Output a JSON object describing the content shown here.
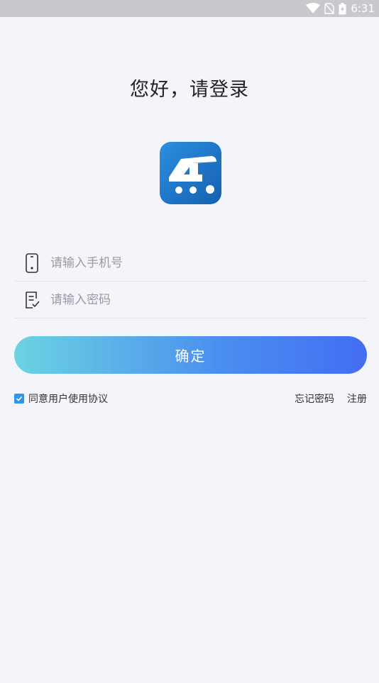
{
  "status_bar": {
    "time": "6:31",
    "icons": [
      "wifi-icon",
      "no-sim-icon",
      "battery-charging-icon"
    ]
  },
  "login": {
    "title": "您好，请登录",
    "logo_icon": "app-logo-icon",
    "phone": {
      "icon": "phone-icon",
      "placeholder": "请输入手机号",
      "value": ""
    },
    "password": {
      "icon": "password-note-icon",
      "placeholder": "请输入密码",
      "value": ""
    },
    "confirm_label": "确定",
    "agreement": {
      "checked": true,
      "label": "同意用户使用协议"
    },
    "forgot_label": "忘记密码",
    "register_label": "注册"
  },
  "colors": {
    "background": "#f4f5fa",
    "status_bar": "#c9c9cd",
    "button_gradient_start": "#6bd3e1",
    "button_gradient_end": "#436df2",
    "checkbox": "#3196e8",
    "logo_blue": "#1a73c8"
  }
}
